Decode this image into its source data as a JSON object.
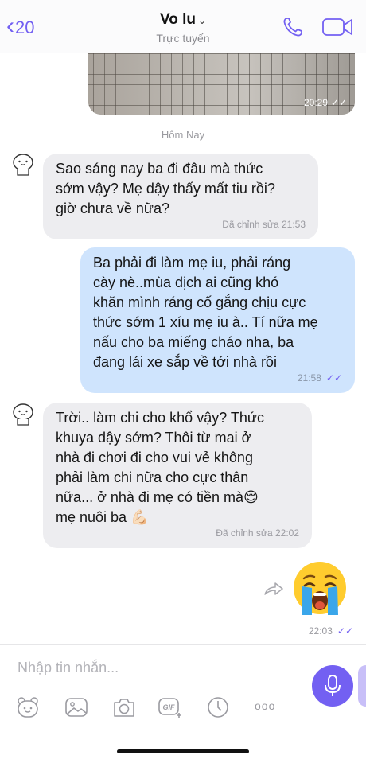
{
  "header": {
    "back_count": "20",
    "contact_name": "Vo lu",
    "status": "Trực tuyến",
    "caret": "⌄"
  },
  "photo_message": {
    "time": "20:29",
    "ticks": "✓✓"
  },
  "date_separator": "Hôm Nay",
  "messages": [
    {
      "direction": "in",
      "lines": [
        "Sao sáng nay ba đi đâu mà thức",
        "sớm vậy? Mẹ dậy thấy mất tiu rồi?",
        "giờ chưa về nữa?"
      ],
      "meta": "Đã chỉnh sửa  21:53"
    },
    {
      "direction": "out",
      "lines": [
        "Ba phải đi làm mẹ iu, phải ráng",
        "cày nè..mùa dịch ai cũng khó",
        "khăn mình ráng cố gắng chịu cực",
        "thức sớm 1 xíu mẹ iu à.. Tí nữa mẹ",
        "nấu cho ba miếng cháo nha, ba",
        "đang lái xe sắp về tới nhà rồi"
      ],
      "time": "21:58",
      "ticks": "✓✓"
    },
    {
      "direction": "in",
      "lines": [
        "Trời.. làm chi cho khổ vậy? Thức",
        "khuya dậy sớm? Thôi từ mai ở",
        "nhà đi chơi đi cho vui vẻ không",
        "phải làm chi nữa cho cực thân",
        "nữa... ở nhà đi mẹ có tiền mà😌",
        "mẹ nuôi ba 💪🏻"
      ],
      "meta": "Đã chỉnh sửa  22:02"
    }
  ],
  "sticker_message": {
    "emoji": "crying-face",
    "time": "22:03",
    "ticks": "✓✓"
  },
  "composer": {
    "placeholder": "Nhập tin nhắn...",
    "tools": [
      "sticker-icon",
      "gallery-icon",
      "camera-icon",
      "gif-icon",
      "clock-icon",
      "more-icon"
    ],
    "more_label": "ooo",
    "gif_label": "GIF"
  },
  "colors": {
    "accent": "#7360f2",
    "bubble_in": "#ededf0",
    "bubble_out": "#cfe4fd"
  }
}
